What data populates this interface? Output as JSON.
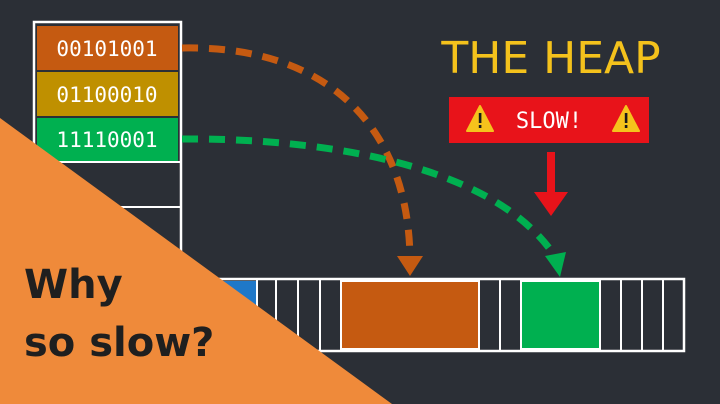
{
  "title": "THE HEAP",
  "warning": {
    "label": "SLOW!",
    "icon": "warning-triangle-icon",
    "color": "#e8131a"
  },
  "registers": [
    {
      "value": "00101001",
      "color": "#c55a11"
    },
    {
      "value": "01100010",
      "color": "#bf9000"
    },
    {
      "value": "11110001",
      "color": "#00b050"
    }
  ],
  "heap_blocks": {
    "orange": "#c55a11",
    "green": "#00b050",
    "blue": "#1f78c8"
  },
  "caption": {
    "line1": "Why",
    "line2": "so slow?"
  },
  "colors": {
    "background": "#2b2f36",
    "title": "#f4c21c",
    "corner": "#ef8a3a"
  }
}
